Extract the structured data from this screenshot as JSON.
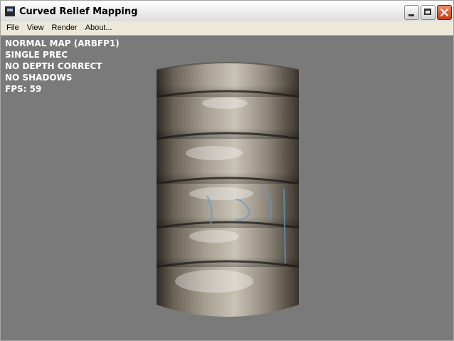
{
  "window": {
    "title": "Curved Relief Mapping"
  },
  "menu": [
    {
      "label": "File"
    },
    {
      "label": "View"
    },
    {
      "label": "Render"
    },
    {
      "label": "About..."
    }
  ],
  "hud": {
    "lines": [
      "NORMAL MAP (ARBFP1)",
      "SINGLE PREC",
      "NO DEPTH CORRECT",
      "NO SHADOWS",
      "FPS: 59"
    ]
  },
  "colors": {
    "viewport_bg": "#7a7a7a",
    "hud_text": "#ffffff",
    "menubar_bg": "#ece9d8"
  },
  "icons": [
    "app-icon",
    "minimize-icon",
    "maximize-icon",
    "close-icon"
  ]
}
